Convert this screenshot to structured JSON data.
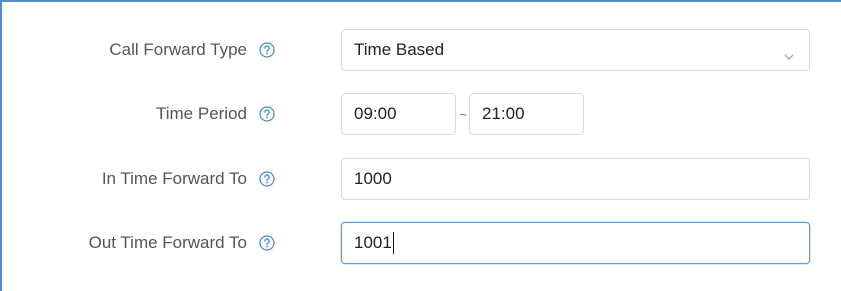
{
  "form": {
    "call_forward_type": {
      "label": "Call Forward Type",
      "value": "Time Based"
    },
    "time_period": {
      "label": "Time Period",
      "start": "09:00",
      "separator": "~",
      "end": "21:00"
    },
    "in_time_forward_to": {
      "label": "In Time Forward To",
      "value": "1000"
    },
    "out_time_forward_to": {
      "label": "Out Time Forward To",
      "value": "1001"
    }
  },
  "icons": {
    "help": "help-circle-icon",
    "dropdown": "chevron-down-icon"
  },
  "colors": {
    "frame_border": "#4a8fd4",
    "focus_border": "#5b9be6",
    "help_icon": "#4a8fd4"
  }
}
